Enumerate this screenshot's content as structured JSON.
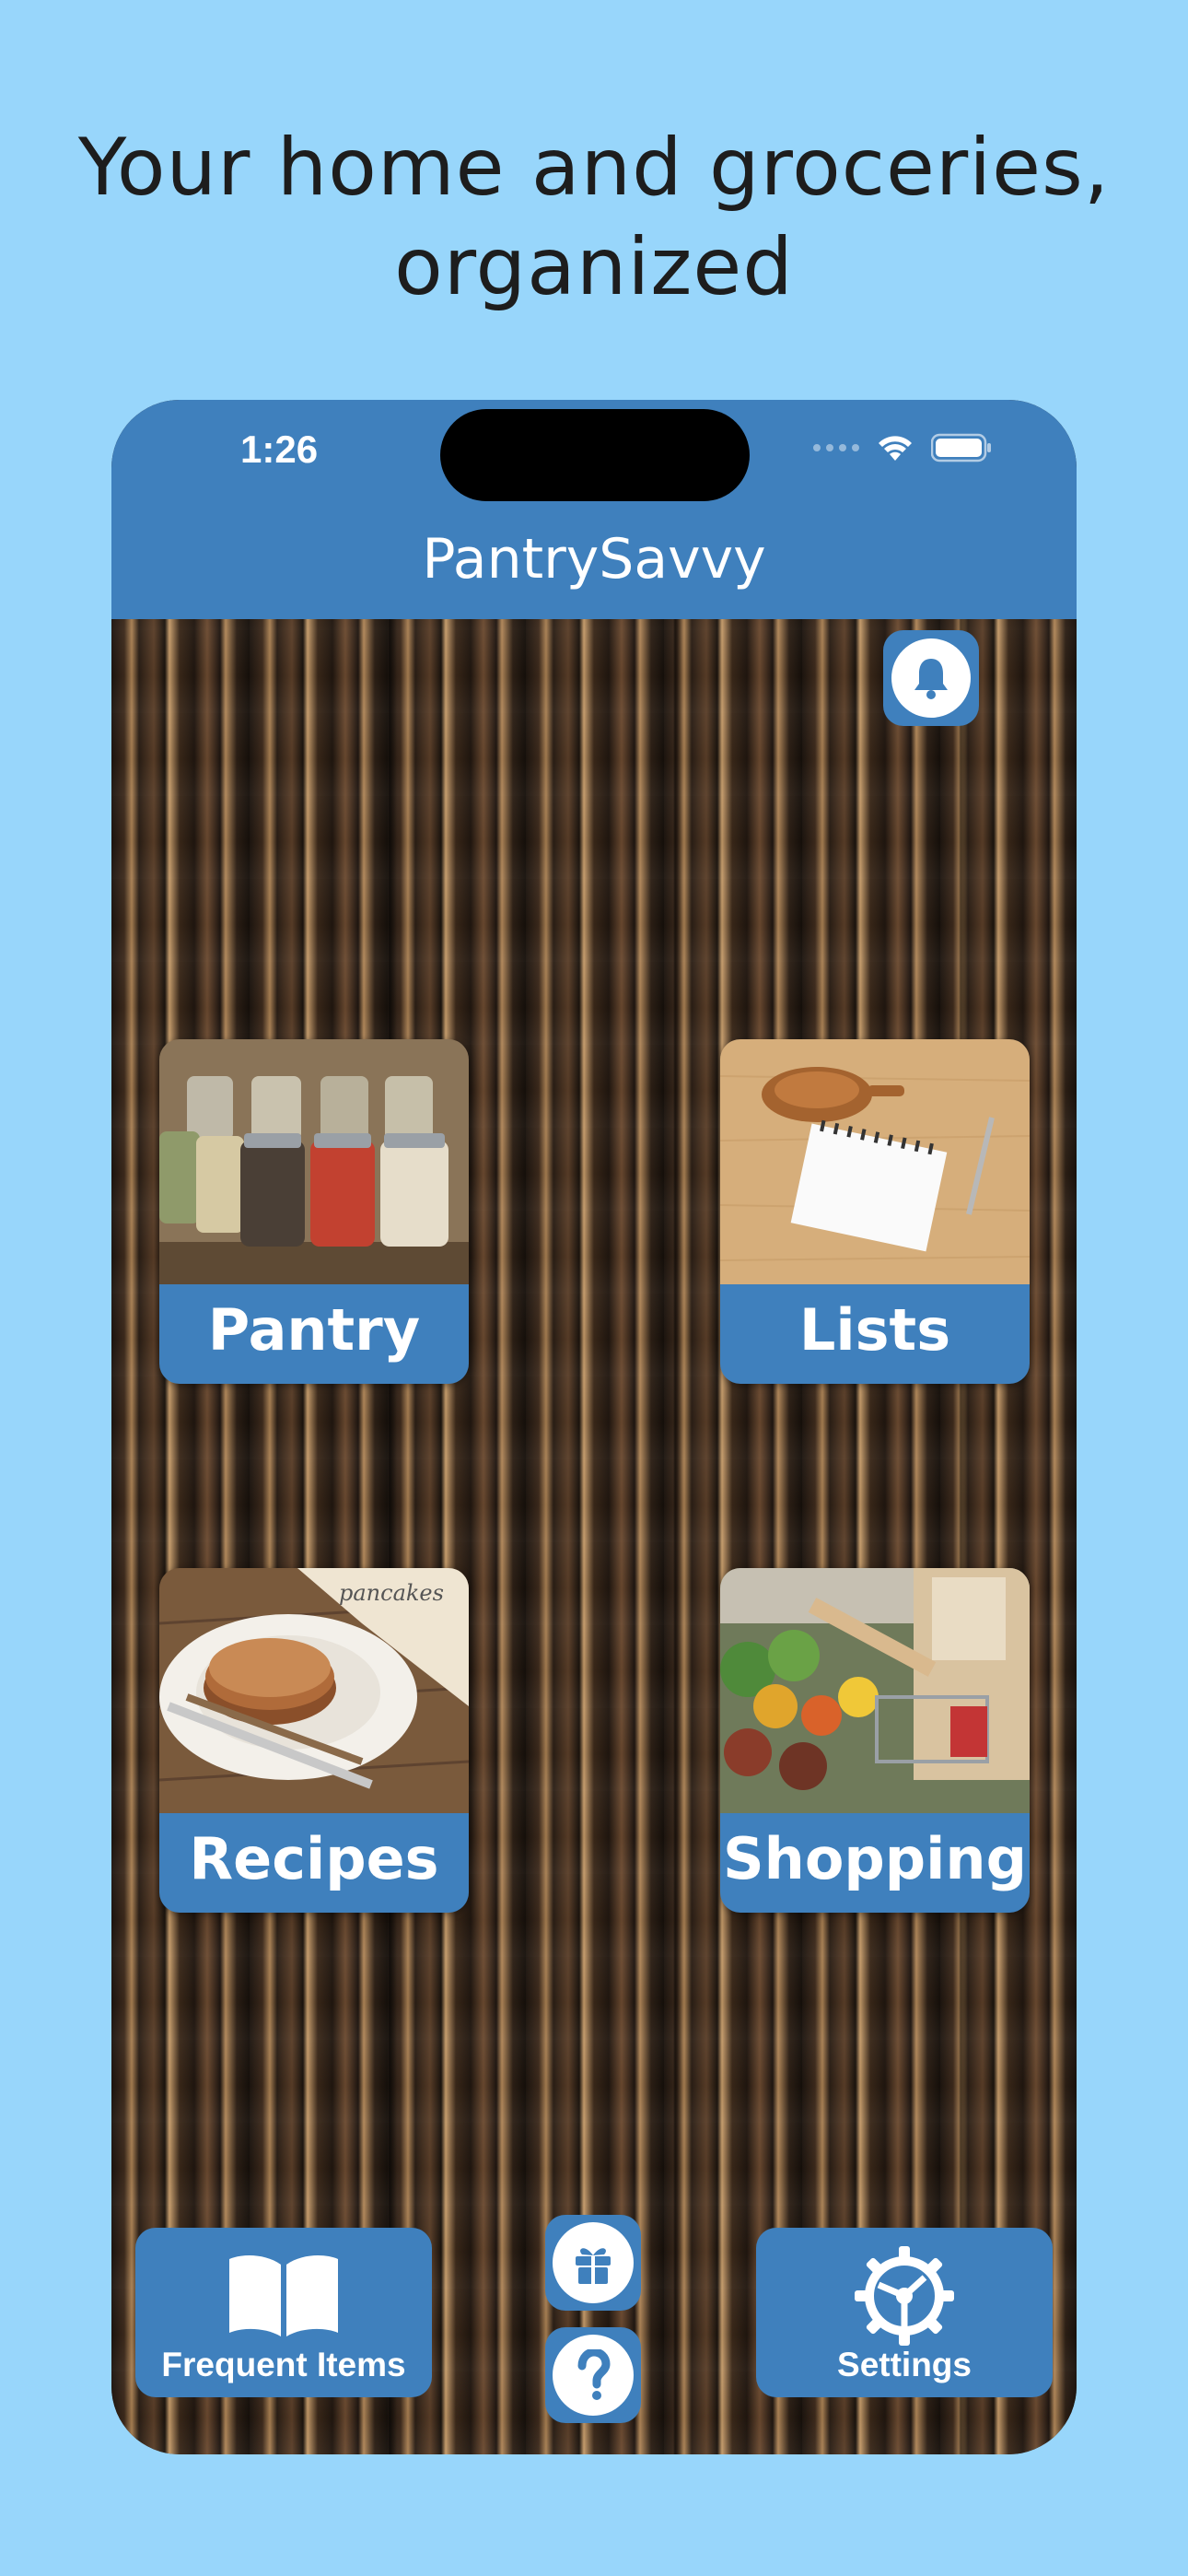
{
  "headline": {
    "line1": "Your home and groceries,",
    "line2": "organized"
  },
  "status_bar": {
    "time": "1:26"
  },
  "app": {
    "title": "PantrySavvy"
  },
  "tiles": [
    {
      "label": "Pantry",
      "image": "spice-jars"
    },
    {
      "label": "Lists",
      "image": "notepad-and-pen"
    },
    {
      "label": "Recipes",
      "image": "pancakes"
    },
    {
      "label": "Shopping",
      "image": "grocery-market"
    }
  ],
  "bottom_bar": {
    "frequent_items": "Frequent Items",
    "settings": "Settings"
  },
  "icons": {
    "notifications": "bell-icon",
    "gift": "gift-icon",
    "help": "question-icon",
    "frequent_items": "book-icon",
    "settings": "gear-icon"
  },
  "colors": {
    "background": "#98d6fb",
    "accent": "#3f80bd",
    "headline_text": "#1d1d1d"
  }
}
